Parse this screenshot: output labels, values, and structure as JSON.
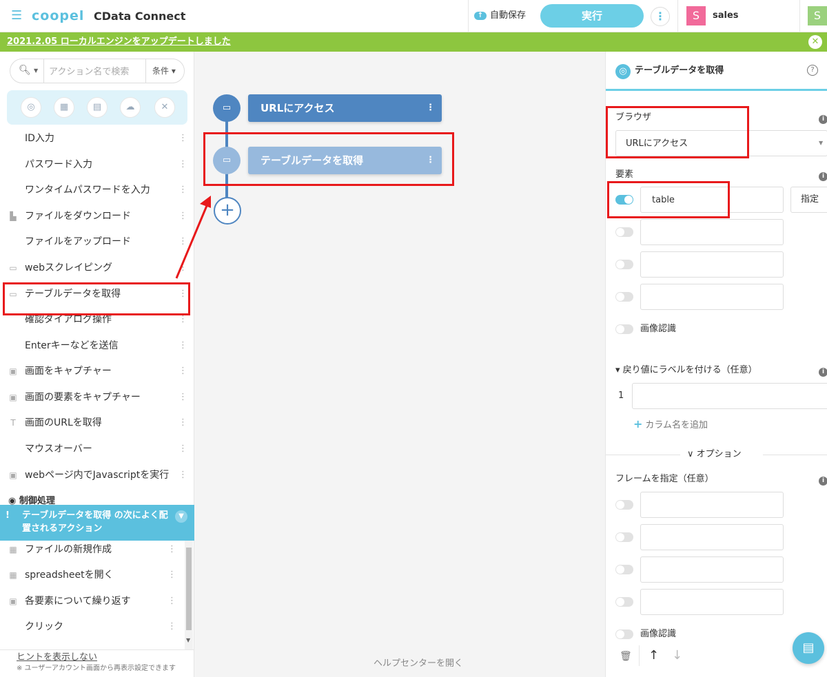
{
  "header": {
    "brand": "coopel",
    "app_title": "CData Connect",
    "autosave_label": "自動保存",
    "run_label": "実行",
    "more_label": "⋮",
    "user_initial": "S",
    "user_name": "sales",
    "user_initial_2": "S"
  },
  "banner": {
    "text": "2021.2.05 ローカルエンジンをアップデートしました",
    "close": "✕"
  },
  "sidebar": {
    "search_placeholder": "アクション名で検索",
    "filter_label": "条件",
    "categories": [
      "globe-icon",
      "excel-icon",
      "file-icon",
      "cloud-icon",
      "tools-icon"
    ],
    "items": [
      {
        "label": "ID入力",
        "icon": ""
      },
      {
        "label": "パスワード入力",
        "icon": ""
      },
      {
        "label": "ワンタイムパスワードを入力",
        "icon": ""
      },
      {
        "label": "ファイルをダウンロード",
        "icon": "file-icon"
      },
      {
        "label": "ファイルをアップロード",
        "icon": ""
      },
      {
        "label": "webスクレイピング",
        "icon": "table-icon"
      },
      {
        "label": "テーブルデータを取得",
        "icon": "table-icon"
      },
      {
        "label": "確認ダイアログ操作",
        "icon": ""
      },
      {
        "label": "Enterキーなどを送信",
        "icon": ""
      },
      {
        "label": "画面をキャプチャー",
        "icon": "image-icon"
      },
      {
        "label": "画面の要素をキャプチャー",
        "icon": "image-icon"
      },
      {
        "label": "画面のURLを取得",
        "icon": "text-icon"
      },
      {
        "label": "マウスオーバー",
        "icon": ""
      },
      {
        "label": "webページ内でJavascriptを実行",
        "icon": "script-icon"
      }
    ],
    "section_control": "制御処理",
    "hint_title": "テーブルデータを取得 の次によく配置されるアクション",
    "suggestions": [
      {
        "label": "ファイルの新規作成",
        "icon": "excel-icon"
      },
      {
        "label": "spreadsheetを開く",
        "icon": "sheet-icon"
      },
      {
        "label": "各要素について繰り返す",
        "icon": "loop-icon"
      },
      {
        "label": "クリック",
        "icon": ""
      }
    ],
    "hide_hint": "ヒントを表示しない",
    "hide_note": "※ ユーザーアカウント画面から再表示設定できます"
  },
  "canvas": {
    "nodes": [
      {
        "label": "URLにアクセス",
        "icon": "browser-icon",
        "state": "active"
      },
      {
        "label": "テーブルデータを取得",
        "icon": "table-icon",
        "state": "selected"
      }
    ],
    "add_label": "+",
    "help_center": "ヘルプセンターを開く"
  },
  "panel": {
    "title": "テーブルデータを取得",
    "browser_label": "ブラウザ",
    "browser_value": "URLにアクセス",
    "element_label": "要素",
    "element_values": [
      "table",
      "",
      "",
      ""
    ],
    "specify_label": "指定",
    "image_recognition": "画像認識",
    "return_label": "▾ 戻り値にラベルを付ける（任意）",
    "return_index": "1",
    "add_column": "カラム名を追加",
    "options_label": "∨ オプション",
    "frame_label": "フレームを指定（任意）",
    "frame_values": [
      "",
      "",
      "",
      ""
    ],
    "image_recognition_2": "画像認識"
  },
  "colors": {
    "accent": "#5bc0de",
    "banner": "#8dc63f",
    "node_active": "#4f86c1",
    "node_selected": "#97b9dd",
    "annotation": "#e8191b"
  }
}
